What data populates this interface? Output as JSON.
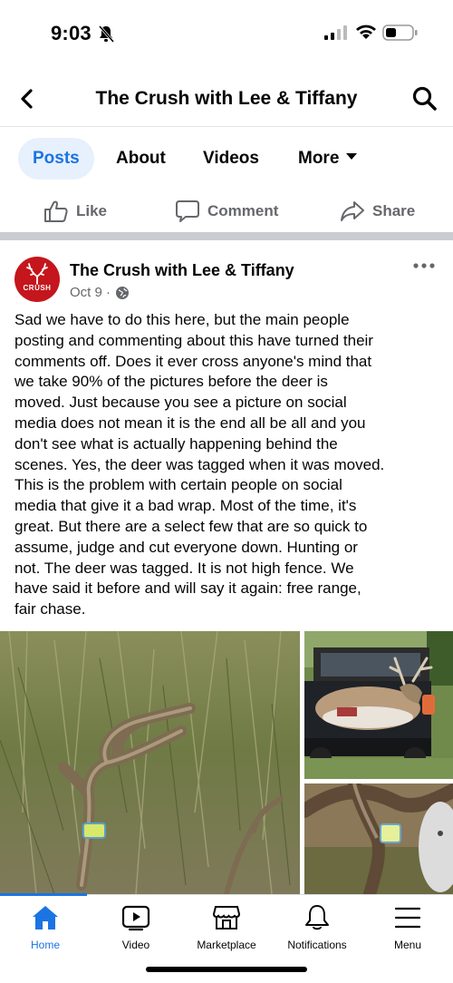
{
  "status_bar": {
    "time": "9:03"
  },
  "header": {
    "title": "The Crush with Lee & Tiffany"
  },
  "tabs": [
    {
      "label": "Posts",
      "active": true
    },
    {
      "label": "About"
    },
    {
      "label": "Videos"
    },
    {
      "label": "More"
    }
  ],
  "actions": {
    "like": "Like",
    "comment": "Comment",
    "share": "Share"
  },
  "post": {
    "author": "The Crush with Lee & Tiffany",
    "avatar_text": "CRUSH",
    "date": "Oct 9 ·",
    "lines": [
      "Sad we have to do this here, but the main people",
      "posting and commenting about this have turned their",
      "comments off. Does it ever cross anyone's mind that",
      "we take 90% of the pictures before the deer is",
      "moved. Just because you see a picture on social",
      "media does not mean it is the end all be all and you",
      "don't see what is actually happening behind the",
      "scenes. Yes, the deer was tagged when it was moved.",
      "This is the problem with certain people on social",
      "media that give it a bad wrap. Most of the time, it's",
      "great. But there are a select few that are so quick to",
      "assume, judge and cut everyone down. Hunting or",
      "not. The deer was tagged. It is not high fence. We",
      "have said it before and will say it again: free range,",
      "fair chase."
    ]
  },
  "bottom_nav": [
    {
      "label": "Home",
      "icon": "home-icon",
      "active": true
    },
    {
      "label": "Video",
      "icon": "video-icon"
    },
    {
      "label": "Marketplace",
      "icon": "marketplace-icon"
    },
    {
      "label": "Notifications",
      "icon": "bell-icon"
    },
    {
      "label": "Menu",
      "icon": "menu-icon"
    }
  ],
  "colors": {
    "accent": "#1b74e4",
    "secondary_text": "#65676b",
    "brand_red": "#c4161c"
  }
}
